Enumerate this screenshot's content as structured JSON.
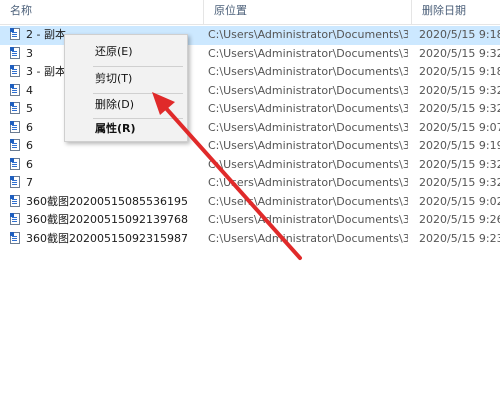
{
  "columns": {
    "name": "名称",
    "location": "原位置",
    "date": "删除日期"
  },
  "rows": [
    {
      "name": "2 - 副本",
      "location": "C:\\Users\\Administrator\\Documents\\3...",
      "date": "2020/5/15 9:18"
    },
    {
      "name": "3",
      "location": "C:\\Users\\Administrator\\Documents\\3...",
      "date": "2020/5/15 9:32"
    },
    {
      "name": "3 - 副本",
      "location": "C:\\Users\\Administrator\\Documents\\3...",
      "date": "2020/5/15 9:18"
    },
    {
      "name": "4",
      "location": "C:\\Users\\Administrator\\Documents\\3...",
      "date": "2020/5/15 9:32"
    },
    {
      "name": "5",
      "location": "C:\\Users\\Administrator\\Documents\\3...",
      "date": "2020/5/15 9:32"
    },
    {
      "name": "6",
      "location": "C:\\Users\\Administrator\\Documents\\3...",
      "date": "2020/5/15 9:07"
    },
    {
      "name": "6",
      "location": "C:\\Users\\Administrator\\Documents\\3...",
      "date": "2020/5/15 9:19"
    },
    {
      "name": "6",
      "location": "C:\\Users\\Administrator\\Documents\\3...",
      "date": "2020/5/15 9:32"
    },
    {
      "name": "7",
      "location": "C:\\Users\\Administrator\\Documents\\3...",
      "date": "2020/5/15 9:32"
    },
    {
      "name": "360截图20200515085536195",
      "location": "C:\\Users\\Administrator\\Documents\\3...",
      "date": "2020/5/15 9:02"
    },
    {
      "name": "360截图20200515092139768",
      "location": "C:\\Users\\Administrator\\Documents\\3...",
      "date": "2020/5/15 9:26"
    },
    {
      "name": "360截图20200515092315987",
      "location": "C:\\Users\\Administrator\\Documents\\3...",
      "date": "2020/5/15 9:23"
    }
  ],
  "context_menu": {
    "restore": "还原(E)",
    "cut": "剪切(T)",
    "delete": "删除(D)",
    "properties": "属性(R)"
  },
  "colors": {
    "selected_row": "#cce8ff",
    "annotation_arrow": "#e02a2a"
  },
  "icons": {
    "file": "text-file-icon"
  }
}
